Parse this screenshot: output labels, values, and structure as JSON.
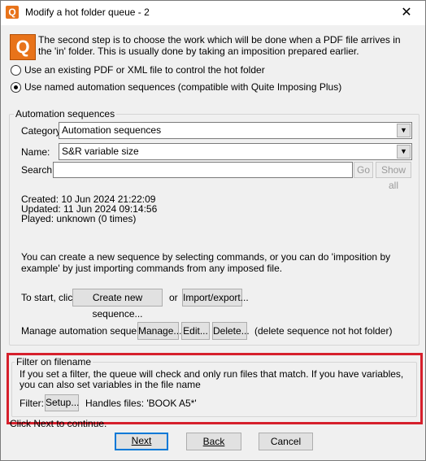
{
  "window": {
    "title": "Modify a hot folder queue - 2",
    "app_icon_letter": "Q",
    "close_glyph": "✕"
  },
  "intro": {
    "logo_letter": "Q",
    "text": "The second step is to choose the work which will be done when a PDF file arrives in the 'in' folder. This is usually done by taking an imposition prepared earlier."
  },
  "options": {
    "pdf_xml_label": "Use an existing PDF or XML file to control the hot folder",
    "sequences_label": "Use named automation sequences (compatible with Quite Imposing Plus)",
    "selected": "sequences"
  },
  "automation": {
    "group_label": "Automation sequences",
    "category_label": "Category:",
    "category_value": "Automation sequences",
    "name_label": "Name:",
    "name_value": "S&R variable size",
    "search_label": "Search:",
    "search_value": "",
    "go_label": "Go",
    "show_all_label": "Show all",
    "created": "Created: 10 Jun 2024 21:22:09",
    "updated": "Updated: 11 Jun 2024 09:14:56",
    "played": "Played: unknown (0 times)",
    "info_text": "You can create a new sequence by selecting commands, or you can do 'imposition by example' by just importing commands from any imposed file.",
    "start_label": "To start, click",
    "create_new_label": "Create new sequence...",
    "or_label": "or",
    "import_export_label": "Import/export...",
    "manage_label": "Manage automation sequences",
    "manage_button": "Manage...",
    "edit_button": "Edit...",
    "delete_button": "Delete...",
    "delete_note": "(delete sequence not hot folder)"
  },
  "filter": {
    "group_label": "Filter on filename",
    "description": "If you set a filter, the queue will check and only run files that match. If you have variables, you can also set variables in the file name",
    "filter_label": "Filter:",
    "setup_button": "Setup...",
    "handles_text": "Handles files: 'BOOK A5*'"
  },
  "footer": {
    "hint": "Click Next to continue.",
    "next_button": "Next",
    "back_button": "Back",
    "cancel_button": "Cancel"
  },
  "colors": {
    "highlight_border": "#d6202c",
    "accent": "#0078d7",
    "logo": "#e8731a"
  }
}
